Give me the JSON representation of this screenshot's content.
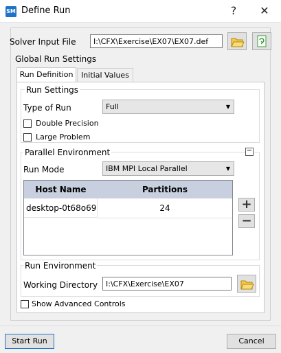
{
  "window": {
    "app_icon_text": "SM",
    "title": "Define Run",
    "help_label": "?",
    "close_label": "✕"
  },
  "solver": {
    "label": "Solver Input File",
    "value": "I:\\CFX\\Exercise\\EX07\\EX07.def"
  },
  "global_settings": {
    "title": "Global Run Settings"
  },
  "tabs": [
    {
      "label": "Run Definition",
      "active": true
    },
    {
      "label": "Initial Values",
      "active": false
    }
  ],
  "run_settings": {
    "title": "Run Settings",
    "type_label": "Type of Run",
    "type_value": "Full",
    "double_precision_label": "Double Precision",
    "large_problem_label": "Large Problem"
  },
  "parallel": {
    "title": "Parallel Environment",
    "collapse_label": "−",
    "run_mode_label": "Run Mode",
    "run_mode_value": "IBM MPI Local Parallel",
    "columns": [
      "Host Name",
      "Partitions"
    ],
    "rows": [
      {
        "host": "desktop-0t68o69",
        "partitions": "24"
      }
    ],
    "add_label": "+",
    "remove_label": "−"
  },
  "run_env": {
    "title": "Run Environment",
    "working_dir_label": "Working Directory",
    "working_dir_value": "I:\\CFX\\Exercise\\EX07"
  },
  "advanced": {
    "label": "Show Advanced Controls"
  },
  "footer": {
    "start_label": "Start Run",
    "cancel_label": "Cancel"
  },
  "colors": {
    "table_header": "#c8d0df",
    "folder": "#e8b63a",
    "refresh": "#3c9d3c",
    "accent": "#1e73c8"
  }
}
